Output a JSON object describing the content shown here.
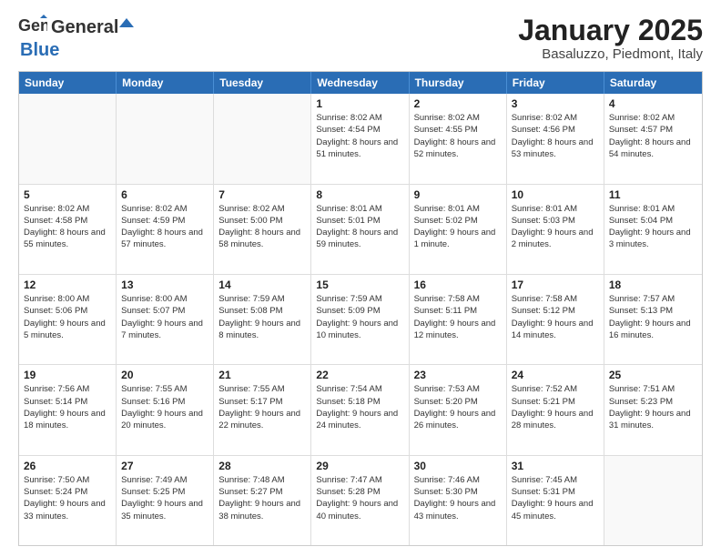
{
  "header": {
    "logo_line1": "General",
    "logo_line2": "Blue",
    "main_title": "January 2025",
    "sub_title": "Basaluzzo, Piedmont, Italy"
  },
  "calendar": {
    "days_of_week": [
      "Sunday",
      "Monday",
      "Tuesday",
      "Wednesday",
      "Thursday",
      "Friday",
      "Saturday"
    ],
    "weeks": [
      [
        {
          "day": "",
          "info": ""
        },
        {
          "day": "",
          "info": ""
        },
        {
          "day": "",
          "info": ""
        },
        {
          "day": "1",
          "info": "Sunrise: 8:02 AM\nSunset: 4:54 PM\nDaylight: 8 hours and 51 minutes."
        },
        {
          "day": "2",
          "info": "Sunrise: 8:02 AM\nSunset: 4:55 PM\nDaylight: 8 hours and 52 minutes."
        },
        {
          "day": "3",
          "info": "Sunrise: 8:02 AM\nSunset: 4:56 PM\nDaylight: 8 hours and 53 minutes."
        },
        {
          "day": "4",
          "info": "Sunrise: 8:02 AM\nSunset: 4:57 PM\nDaylight: 8 hours and 54 minutes."
        }
      ],
      [
        {
          "day": "5",
          "info": "Sunrise: 8:02 AM\nSunset: 4:58 PM\nDaylight: 8 hours and 55 minutes."
        },
        {
          "day": "6",
          "info": "Sunrise: 8:02 AM\nSunset: 4:59 PM\nDaylight: 8 hours and 57 minutes."
        },
        {
          "day": "7",
          "info": "Sunrise: 8:02 AM\nSunset: 5:00 PM\nDaylight: 8 hours and 58 minutes."
        },
        {
          "day": "8",
          "info": "Sunrise: 8:01 AM\nSunset: 5:01 PM\nDaylight: 8 hours and 59 minutes."
        },
        {
          "day": "9",
          "info": "Sunrise: 8:01 AM\nSunset: 5:02 PM\nDaylight: 9 hours and 1 minute."
        },
        {
          "day": "10",
          "info": "Sunrise: 8:01 AM\nSunset: 5:03 PM\nDaylight: 9 hours and 2 minutes."
        },
        {
          "day": "11",
          "info": "Sunrise: 8:01 AM\nSunset: 5:04 PM\nDaylight: 9 hours and 3 minutes."
        }
      ],
      [
        {
          "day": "12",
          "info": "Sunrise: 8:00 AM\nSunset: 5:06 PM\nDaylight: 9 hours and 5 minutes."
        },
        {
          "day": "13",
          "info": "Sunrise: 8:00 AM\nSunset: 5:07 PM\nDaylight: 9 hours and 7 minutes."
        },
        {
          "day": "14",
          "info": "Sunrise: 7:59 AM\nSunset: 5:08 PM\nDaylight: 9 hours and 8 minutes."
        },
        {
          "day": "15",
          "info": "Sunrise: 7:59 AM\nSunset: 5:09 PM\nDaylight: 9 hours and 10 minutes."
        },
        {
          "day": "16",
          "info": "Sunrise: 7:58 AM\nSunset: 5:11 PM\nDaylight: 9 hours and 12 minutes."
        },
        {
          "day": "17",
          "info": "Sunrise: 7:58 AM\nSunset: 5:12 PM\nDaylight: 9 hours and 14 minutes."
        },
        {
          "day": "18",
          "info": "Sunrise: 7:57 AM\nSunset: 5:13 PM\nDaylight: 9 hours and 16 minutes."
        }
      ],
      [
        {
          "day": "19",
          "info": "Sunrise: 7:56 AM\nSunset: 5:14 PM\nDaylight: 9 hours and 18 minutes."
        },
        {
          "day": "20",
          "info": "Sunrise: 7:55 AM\nSunset: 5:16 PM\nDaylight: 9 hours and 20 minutes."
        },
        {
          "day": "21",
          "info": "Sunrise: 7:55 AM\nSunset: 5:17 PM\nDaylight: 9 hours and 22 minutes."
        },
        {
          "day": "22",
          "info": "Sunrise: 7:54 AM\nSunset: 5:18 PM\nDaylight: 9 hours and 24 minutes."
        },
        {
          "day": "23",
          "info": "Sunrise: 7:53 AM\nSunset: 5:20 PM\nDaylight: 9 hours and 26 minutes."
        },
        {
          "day": "24",
          "info": "Sunrise: 7:52 AM\nSunset: 5:21 PM\nDaylight: 9 hours and 28 minutes."
        },
        {
          "day": "25",
          "info": "Sunrise: 7:51 AM\nSunset: 5:23 PM\nDaylight: 9 hours and 31 minutes."
        }
      ],
      [
        {
          "day": "26",
          "info": "Sunrise: 7:50 AM\nSunset: 5:24 PM\nDaylight: 9 hours and 33 minutes."
        },
        {
          "day": "27",
          "info": "Sunrise: 7:49 AM\nSunset: 5:25 PM\nDaylight: 9 hours and 35 minutes."
        },
        {
          "day": "28",
          "info": "Sunrise: 7:48 AM\nSunset: 5:27 PM\nDaylight: 9 hours and 38 minutes."
        },
        {
          "day": "29",
          "info": "Sunrise: 7:47 AM\nSunset: 5:28 PM\nDaylight: 9 hours and 40 minutes."
        },
        {
          "day": "30",
          "info": "Sunrise: 7:46 AM\nSunset: 5:30 PM\nDaylight: 9 hours and 43 minutes."
        },
        {
          "day": "31",
          "info": "Sunrise: 7:45 AM\nSunset: 5:31 PM\nDaylight: 9 hours and 45 minutes."
        },
        {
          "day": "",
          "info": ""
        }
      ]
    ]
  }
}
